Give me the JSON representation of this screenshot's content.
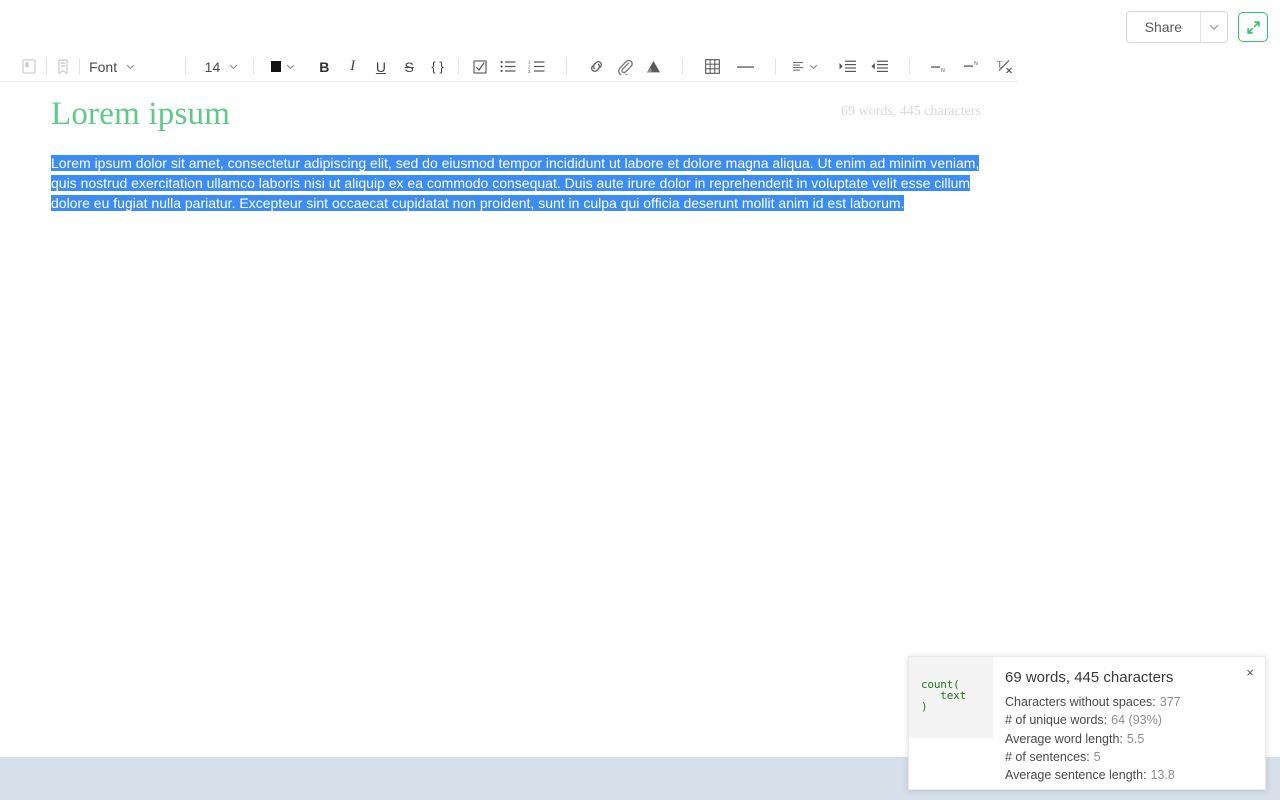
{
  "header": {
    "share_label": "Share",
    "share_caret_icon": "chevron-down-icon",
    "expand_icon": "expand-fullscreen-icon"
  },
  "toolbar": {
    "items": [
      {
        "name": "save-book-icon",
        "icon": "book-icon",
        "type": "icon",
        "faded": true
      },
      {
        "name": "bookmark-tag-icon",
        "icon": "tag-icon",
        "type": "icon",
        "faded": true
      },
      {
        "name": "font-family-dropdown",
        "label": "Font",
        "type": "dropdown"
      },
      {
        "name": "font-size-dropdown",
        "label": "14",
        "type": "dropdown"
      },
      {
        "name": "text-color-picker",
        "icon": "color-swatch-icon",
        "type": "swatch",
        "color": "#111111"
      },
      {
        "name": "bold-button",
        "label": "B",
        "type": "text-style"
      },
      {
        "name": "italic-button",
        "label": "I",
        "type": "text-style"
      },
      {
        "name": "underline-button",
        "label": "U",
        "type": "text-style"
      },
      {
        "name": "strikethrough-button",
        "label": "S",
        "type": "text-style"
      },
      {
        "name": "code-block-button",
        "label": "{ }",
        "type": "text-style"
      },
      {
        "name": "checklist-button",
        "icon": "checkbox-icon",
        "type": "icon"
      },
      {
        "name": "bulleted-list-button",
        "icon": "bullet-list-icon",
        "type": "icon"
      },
      {
        "name": "numbered-list-button",
        "icon": "numbered-list-icon",
        "type": "icon"
      },
      {
        "name": "insert-link-button",
        "icon": "link-icon",
        "type": "icon"
      },
      {
        "name": "attach-file-button",
        "icon": "paperclip-icon",
        "type": "icon"
      },
      {
        "name": "insert-drive-file-button",
        "icon": "drive-icon",
        "type": "icon"
      },
      {
        "name": "insert-table-button",
        "icon": "table-icon",
        "type": "icon"
      },
      {
        "name": "horizontal-rule-button",
        "icon": "horizontal-rule-icon",
        "type": "icon"
      },
      {
        "name": "text-align-dropdown",
        "icon": "align-left-icon",
        "type": "icon-dropdown"
      },
      {
        "name": "increase-indent-button",
        "icon": "indent-increase-icon",
        "type": "icon"
      },
      {
        "name": "decrease-indent-button",
        "icon": "indent-decrease-icon",
        "type": "icon"
      },
      {
        "name": "subscript-button",
        "icon": "subscript-icon",
        "type": "icon",
        "faded": true
      },
      {
        "name": "superscript-button",
        "icon": "superscript-icon",
        "type": "icon",
        "faded": true
      },
      {
        "name": "clear-formatting-button",
        "icon": "clear-formatting-icon",
        "type": "icon",
        "faded": true
      }
    ]
  },
  "document": {
    "title": "Lorem ipsum",
    "word_count_label": "69 words, 445 characters",
    "body_text": "Lorem ipsum dolor sit amet, consectetur adipiscing elit, sed do eiusmod tempor incididunt ut labore et dolore magna aliqua. Ut enim ad minim veniam, quis nostrud exercitation ullamco laboris nisi ut aliquip ex ea commodo consequat. Duis aute irure dolor in reprehenderit in voluptate velit esse cillum dolore eu fugiat nulla pariatur. Excepteur sint occaecat cupidatat non proident, sunt in culpa qui officia deserunt mollit anim id est laborum.",
    "selection_color": "#3b8cf4",
    "title_color": "#5fc98a"
  },
  "stats_panel": {
    "logo_text": "count(\n   text\n)",
    "title": "69 words, 445 characters",
    "close_icon": "close-icon",
    "rows": [
      {
        "label": "Characters without spaces:",
        "value": "377"
      },
      {
        "label": "# of unique words:",
        "value": "64 (93%)"
      },
      {
        "label": "Average word length:",
        "value": "5.5"
      },
      {
        "label": "# of sentences:",
        "value": "5"
      },
      {
        "label": "Average sentence length:",
        "value": "13.8"
      }
    ]
  },
  "colors": {
    "accent_green": "#2ec46b",
    "selection_blue": "#3b8cf4",
    "bottom_band": "#d6dfea"
  }
}
